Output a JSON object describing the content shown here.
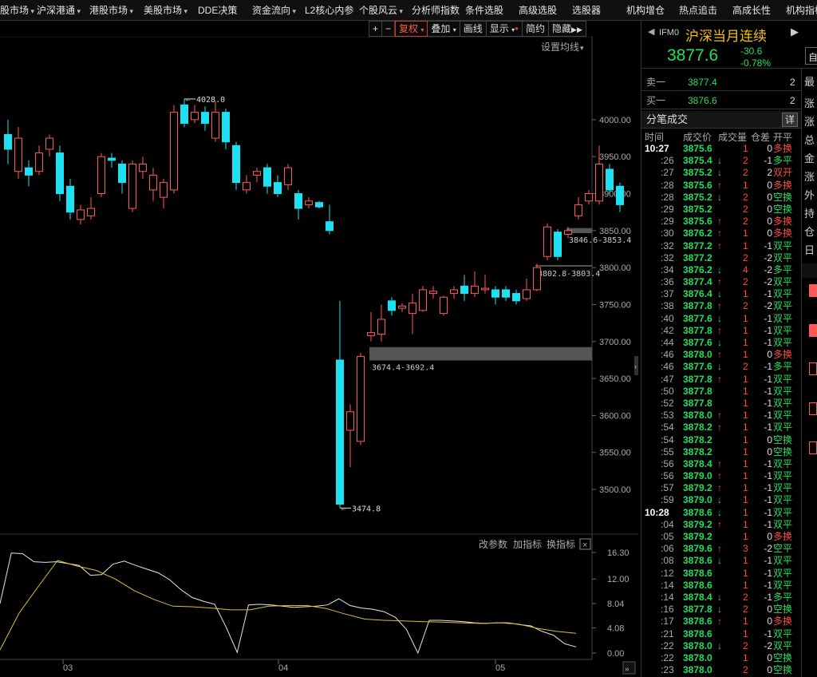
{
  "menu": [
    {
      "label": "股市场",
      "has_dropdown": true
    },
    {
      "label": "沪深港通",
      "has_dropdown": true
    },
    {
      "label": "港股市场",
      "has_dropdown": true
    },
    {
      "label": "美股市场",
      "has_dropdown": true
    },
    {
      "label": "DDE决策",
      "has_dropdown": false
    },
    {
      "label": "资金流向",
      "has_dropdown": true
    },
    {
      "label": "L2核心内参",
      "has_dropdown": false
    },
    {
      "label": "个股风云",
      "has_dropdown": true
    },
    {
      "label": "分析师指数",
      "has_dropdown": false
    },
    {
      "label": "条件选股",
      "has_dropdown": false
    },
    {
      "label": "高级选股",
      "has_dropdown": false
    },
    {
      "label": "选股器",
      "has_dropdown": false
    },
    {
      "label": "机构增仓",
      "has_dropdown": false
    },
    {
      "label": "热点追击",
      "has_dropdown": false
    },
    {
      "label": "高成长性",
      "has_dropdown": false
    },
    {
      "label": "机构指标",
      "has_dropdown": false
    }
  ],
  "toolbar": {
    "plus": "+",
    "minus": "−",
    "fuquan": "复权",
    "diejia": "叠加",
    "huaxian": "画线",
    "xianshi": "显示",
    "jianyue": "简约",
    "yincang": "隐藏"
  },
  "chart_settings_label": "设置均线",
  "indicator_toolbar": {
    "params": "改参数",
    "add": "加指标",
    "change": "换指标"
  },
  "colors": {
    "up": "#ff5a5a",
    "down": "#1ee0f0",
    "bg": "#000000",
    "indicator_white": "#e8e8e8",
    "indicator_yellow": "#d8c02a",
    "price_green": "#22e05a",
    "price_red": "#ff4a3a"
  },
  "chart_data": {
    "type": "candlestick",
    "y_axis": {
      "ticks": [
        "4000.00",
        "3950.00",
        "3900.00",
        "3850.00",
        "3800.00",
        "3750.00",
        "3700.00",
        "3650.00",
        "3600.00",
        "3550.00",
        "3500.00"
      ],
      "range": [
        3445,
        4110
      ]
    },
    "x_axis": {
      "date_labels": [
        "03",
        "04",
        "05"
      ]
    },
    "candles": [
      {
        "o": 3980,
        "c": 3960,
        "h": 4000,
        "l": 3940
      },
      {
        "o": 3930,
        "c": 3975,
        "h": 3990,
        "l": 3920
      },
      {
        "o": 3935,
        "c": 3925,
        "h": 3945,
        "l": 3910
      },
      {
        "o": 3930,
        "c": 3955,
        "h": 3965,
        "l": 3925
      },
      {
        "o": 3960,
        "c": 3975,
        "h": 3980,
        "l": 3950
      },
      {
        "o": 3955,
        "c": 3900,
        "h": 3965,
        "l": 3890
      },
      {
        "o": 3910,
        "c": 3875,
        "h": 3920,
        "l": 3865
      },
      {
        "o": 3865,
        "c": 3878,
        "h": 3885,
        "l": 3858
      },
      {
        "o": 3870,
        "c": 3880,
        "h": 3895,
        "l": 3865
      },
      {
        "o": 3900,
        "c": 3950,
        "h": 3955,
        "l": 3895
      },
      {
        "o": 3948,
        "c": 3945,
        "h": 3955,
        "l": 3935
      },
      {
        "o": 3940,
        "c": 3915,
        "h": 3945,
        "l": 3900
      },
      {
        "o": 3880,
        "c": 3940,
        "h": 3945,
        "l": 3875
      },
      {
        "o": 3930,
        "c": 3940,
        "h": 3950,
        "l": 3920
      },
      {
        "o": 3905,
        "c": 3925,
        "h": 3935,
        "l": 3890
      },
      {
        "o": 3895,
        "c": 3915,
        "h": 3920,
        "l": 3880
      },
      {
        "o": 3905,
        "c": 4010,
        "h": 4020,
        "l": 3900
      },
      {
        "o": 4020,
        "c": 3995,
        "h": 4028,
        "l": 3990
      },
      {
        "o": 4000,
        "c": 4010,
        "h": 4020,
        "l": 3995
      },
      {
        "o": 4010,
        "c": 3995,
        "h": 4018,
        "l": 3985
      },
      {
        "o": 3975,
        "c": 4010,
        "h": 4025,
        "l": 3970
      },
      {
        "o": 4010,
        "c": 3970,
        "h": 4015,
        "l": 3960
      },
      {
        "o": 3965,
        "c": 3915,
        "h": 3970,
        "l": 3905
      },
      {
        "o": 3905,
        "c": 3915,
        "h": 3925,
        "l": 3900
      },
      {
        "o": 3925,
        "c": 3930,
        "h": 3935,
        "l": 3915
      },
      {
        "o": 3935,
        "c": 3910,
        "h": 3940,
        "l": 3900
      },
      {
        "o": 3915,
        "c": 3900,
        "h": 3925,
        "l": 3895
      },
      {
        "o": 3912,
        "c": 3935,
        "h": 3940,
        "l": 3905
      },
      {
        "o": 3900,
        "c": 3880,
        "h": 3905,
        "l": 3865
      },
      {
        "o": 3885,
        "c": 3890,
        "h": 3895,
        "l": 3880
      },
      {
        "o": 3888,
        "c": 3882,
        "h": 3890,
        "l": 3880
      },
      {
        "o": 3862,
        "c": 3850,
        "h": 3885,
        "l": 3845
      },
      {
        "o": 3675,
        "c": 3480,
        "h": 3755,
        "l": 3474.8
      },
      {
        "o": 3580,
        "c": 3605,
        "h": 3615,
        "l": 3530
      },
      {
        "o": 3565,
        "c": 3680,
        "h": 3685,
        "l": 3560
      },
      {
        "o": 3708,
        "c": 3712,
        "h": 3740,
        "l": 3700
      },
      {
        "o": 3710,
        "c": 3730,
        "h": 3750,
        "l": 3700
      },
      {
        "o": 3755,
        "c": 3742,
        "h": 3760,
        "l": 3735
      },
      {
        "o": 3745,
        "c": 3748,
        "h": 3752,
        "l": 3740
      },
      {
        "o": 3738,
        "c": 3752,
        "h": 3765,
        "l": 3710
      },
      {
        "o": 3742,
        "c": 3770,
        "h": 3775,
        "l": 3740
      },
      {
        "o": 3765,
        "c": 3768,
        "h": 3775,
        "l": 3758
      },
      {
        "o": 3738,
        "c": 3760,
        "h": 3762,
        "l": 3735
      },
      {
        "o": 3765,
        "c": 3770,
        "h": 3775,
        "l": 3758
      },
      {
        "o": 3775,
        "c": 3765,
        "h": 3790,
        "l": 3755
      },
      {
        "o": 3765,
        "c": 3775,
        "h": 3795,
        "l": 3760
      },
      {
        "o": 3770,
        "c": 3772,
        "h": 3790,
        "l": 3765
      },
      {
        "o": 3770,
        "c": 3760,
        "h": 3775,
        "l": 3750
      },
      {
        "o": 3770,
        "c": 3760,
        "h": 3775,
        "l": 3755
      },
      {
        "o": 3765,
        "c": 3755,
        "h": 3770,
        "l": 3750
      },
      {
        "o": 3758,
        "c": 3770,
        "h": 3785,
        "l": 3755
      },
      {
        "o": 3770,
        "c": 3800,
        "h": 3805,
        "l": 3768
      },
      {
        "o": 3815,
        "c": 3855,
        "h": 3860,
        "l": 3810
      },
      {
        "o": 3848,
        "c": 3815,
        "h": 3852,
        "l": 3810
      },
      {
        "o": 3845,
        "c": 3850,
        "h": 3855,
        "l": 3840
      },
      {
        "o": 3870,
        "c": 3885,
        "h": 3895,
        "l": 3865
      },
      {
        "o": 3890,
        "c": 3900,
        "h": 3905,
        "l": 3885
      },
      {
        "o": 3890,
        "c": 3940,
        "h": 3965,
        "l": 3885
      },
      {
        "o": 3933,
        "c": 3905,
        "h": 3940,
        "l": 3900
      },
      {
        "o": 3910,
        "c": 3885,
        "h": 3915,
        "l": 3875
      }
    ],
    "annotations": [
      {
        "text": "4028.0",
        "price": 4028,
        "candle": 17
      },
      {
        "text": "3474.8",
        "price": 3474.8,
        "candle": 32
      }
    ],
    "gaps": [
      {
        "label": "3674.4-3692.4",
        "low": 3674.4,
        "high": 3692.4,
        "from_candle": 35
      },
      {
        "label": "3802.8-3803.4",
        "low": 3802.8,
        "high": 3803.4,
        "from_candle": 51
      },
      {
        "label": "3846.6-3853.4",
        "low": 3846.6,
        "high": 3853.4,
        "from_candle": 54
      }
    ],
    "indicator": {
      "y_ticks": [
        "16.30",
        "12.00",
        "8.04",
        "4.08",
        "0.00"
      ],
      "range": [
        0,
        16.3
      ],
      "series": [
        {
          "color": "white",
          "values": [
            8.0,
            16.2,
            16.1,
            14.8,
            14.7,
            14.8,
            14.5,
            14.2,
            12.6,
            12.7,
            14.4,
            14.9,
            14.2,
            13.6,
            13.0,
            11.9,
            10.3,
            9.0,
            8.4,
            7.9,
            4.3,
            0.1,
            7.8,
            7.9,
            7.8,
            7.6,
            7.4,
            7.5,
            7.6,
            7.8,
            8.8,
            7.7,
            7.3,
            7.1,
            6.7,
            5.8,
            3.8,
            0.0,
            5.3,
            5.3,
            5.2,
            5.1,
            4.9,
            4.8,
            4.9,
            4.9,
            4.6,
            4.4,
            3.5,
            2.9,
            1.5,
            1.0
          ]
        },
        {
          "color": "yellow",
          "values": [
            0.5,
            6.5,
            10.8,
            15.0,
            14.1,
            13.4,
            12.0,
            10.1,
            8.7,
            7.6,
            7.5,
            7.3,
            7.0,
            7.0,
            7.6,
            7.7,
            7.7,
            7.2,
            6.3,
            5.5,
            5.3,
            5.2,
            5.1,
            5.0,
            4.9,
            4.8,
            4.9,
            4.7,
            4.0,
            3.5,
            3.2
          ]
        }
      ]
    }
  },
  "quote": {
    "code": "IFM0",
    "name": "沪深当月连续",
    "price": "3877.6",
    "change": "-30.6",
    "change_pct": "-0.78%",
    "sell1": {
      "label": "卖一",
      "price": "3877.4",
      "vol": "2"
    },
    "buy1": {
      "label": "买一",
      "price": "3876.6",
      "vol": "2"
    },
    "side_labels": [
      "最",
      "涨",
      "涨",
      "总",
      "金",
      "涨",
      "外",
      "持",
      "仓",
      "日"
    ],
    "tape_title": "分笔成交",
    "tape_btn": "详",
    "tape_headers": [
      "时间",
      "成交价",
      "成交量",
      "仓差",
      "开平"
    ]
  },
  "ticks": [
    {
      "t": "10:27",
      "p": "3875.6",
      "a": "",
      "v": "1",
      "d": "0",
      "k": "多换",
      "pc": "g",
      "kc": "r"
    },
    {
      "t": ":26",
      "p": "3875.4",
      "a": "↓",
      "v": "2",
      "d": "-1",
      "k": "多平",
      "pc": "g",
      "kc": "g"
    },
    {
      "t": ":27",
      "p": "3875.2",
      "a": "↓",
      "v": "2",
      "d": "2",
      "k": "双开",
      "pc": "g",
      "kc": "r"
    },
    {
      "t": ":28",
      "p": "3875.6",
      "a": "↑",
      "v": "1",
      "d": "0",
      "k": "多换",
      "pc": "g",
      "kc": "r"
    },
    {
      "t": ":28",
      "p": "3875.2",
      "a": "↓",
      "v": "2",
      "d": "0",
      "k": "空换",
      "pc": "g",
      "kc": "g"
    },
    {
      "t": ":29",
      "p": "3875.2",
      "a": "",
      "v": "2",
      "d": "0",
      "k": "空换",
      "pc": "g",
      "kc": "g"
    },
    {
      "t": ":29",
      "p": "3875.6",
      "a": "↑",
      "v": "2",
      "d": "0",
      "k": "多换",
      "pc": "g",
      "kc": "r"
    },
    {
      "t": ":30",
      "p": "3876.2",
      "a": "↑",
      "v": "1",
      "d": "0",
      "k": "多换",
      "pc": "g",
      "kc": "r"
    },
    {
      "t": ":32",
      "p": "3877.2",
      "a": "↑",
      "v": "1",
      "d": "-1",
      "k": "双平",
      "pc": "g",
      "kc": "g"
    },
    {
      "t": ":32",
      "p": "3877.2",
      "a": "",
      "v": "2",
      "d": "-2",
      "k": "双平",
      "pc": "g",
      "kc": "g"
    },
    {
      "t": ":34",
      "p": "3876.2",
      "a": "↓",
      "v": "4",
      "d": "-2",
      "k": "多平",
      "pc": "g",
      "kc": "g"
    },
    {
      "t": ":36",
      "p": "3877.4",
      "a": "↑",
      "v": "2",
      "d": "-2",
      "k": "双平",
      "pc": "g",
      "kc": "g"
    },
    {
      "t": ":37",
      "p": "3876.4",
      "a": "↓",
      "v": "1",
      "d": "-1",
      "k": "双平",
      "pc": "g",
      "kc": "g"
    },
    {
      "t": ":38",
      "p": "3877.8",
      "a": "↑",
      "v": "2",
      "d": "-2",
      "k": "双平",
      "pc": "g",
      "kc": "g"
    },
    {
      "t": ":40",
      "p": "3877.6",
      "a": "↓",
      "v": "1",
      "d": "-1",
      "k": "双平",
      "pc": "g",
      "kc": "g"
    },
    {
      "t": ":42",
      "p": "3877.8",
      "a": "↑",
      "v": "1",
      "d": "-1",
      "k": "双平",
      "pc": "g",
      "kc": "g"
    },
    {
      "t": ":44",
      "p": "3877.6",
      "a": "↓",
      "v": "1",
      "d": "-1",
      "k": "双平",
      "pc": "g",
      "kc": "g"
    },
    {
      "t": ":46",
      "p": "3878.0",
      "a": "↑",
      "v": "1",
      "d": "0",
      "k": "多换",
      "pc": "g",
      "kc": "r"
    },
    {
      "t": ":46",
      "p": "3877.6",
      "a": "↓",
      "v": "2",
      "d": "-1",
      "k": "多平",
      "pc": "g",
      "kc": "g"
    },
    {
      "t": ":47",
      "p": "3877.8",
      "a": "↑",
      "v": "1",
      "d": "-1",
      "k": "双平",
      "pc": "g",
      "kc": "g"
    },
    {
      "t": ":50",
      "p": "3877.8",
      "a": "",
      "v": "1",
      "d": "-1",
      "k": "双平",
      "pc": "g",
      "kc": "g"
    },
    {
      "t": ":52",
      "p": "3877.8",
      "a": "",
      "v": "1",
      "d": "-1",
      "k": "双平",
      "pc": "g",
      "kc": "g"
    },
    {
      "t": ":53",
      "p": "3878.0",
      "a": "↑",
      "v": "1",
      "d": "-1",
      "k": "双平",
      "pc": "g",
      "kc": "g"
    },
    {
      "t": ":54",
      "p": "3878.2",
      "a": "↑",
      "v": "1",
      "d": "-1",
      "k": "双平",
      "pc": "g",
      "kc": "g"
    },
    {
      "t": ":54",
      "p": "3878.2",
      "a": "",
      "v": "1",
      "d": "0",
      "k": "空换",
      "pc": "g",
      "kc": "g"
    },
    {
      "t": ":55",
      "p": "3878.2",
      "a": "",
      "v": "1",
      "d": "0",
      "k": "空换",
      "pc": "g",
      "kc": "g"
    },
    {
      "t": ":56",
      "p": "3878.4",
      "a": "↑",
      "v": "1",
      "d": "-1",
      "k": "双平",
      "pc": "g",
      "kc": "g"
    },
    {
      "t": ":56",
      "p": "3879.0",
      "a": "↑",
      "v": "1",
      "d": "-1",
      "k": "双平",
      "pc": "g",
      "kc": "g"
    },
    {
      "t": ":57",
      "p": "3879.2",
      "a": "↑",
      "v": "1",
      "d": "-1",
      "k": "双平",
      "pc": "g",
      "kc": "g"
    },
    {
      "t": ":59",
      "p": "3879.0",
      "a": "↓",
      "v": "1",
      "d": "-1",
      "k": "双平",
      "pc": "g",
      "kc": "g"
    },
    {
      "t": "10:28",
      "p": "3878.6",
      "a": "↓",
      "v": "1",
      "d": "-1",
      "k": "双平",
      "pc": "g",
      "kc": "g"
    },
    {
      "t": ":04",
      "p": "3879.2",
      "a": "↑",
      "v": "1",
      "d": "-1",
      "k": "双平",
      "pc": "g",
      "kc": "g"
    },
    {
      "t": ":05",
      "p": "3879.2",
      "a": "",
      "v": "1",
      "d": "0",
      "k": "多换",
      "pc": "g",
      "kc": "r"
    },
    {
      "t": ":06",
      "p": "3879.6",
      "a": "↑",
      "v": "3",
      "d": "-2",
      "k": "空平",
      "pc": "g",
      "kc": "g"
    },
    {
      "t": ":08",
      "p": "3878.6",
      "a": "↓",
      "v": "1",
      "d": "-1",
      "k": "双平",
      "pc": "g",
      "kc": "g"
    },
    {
      "t": ":12",
      "p": "3878.6",
      "a": "",
      "v": "1",
      "d": "-1",
      "k": "双平",
      "pc": "g",
      "kc": "g"
    },
    {
      "t": ":14",
      "p": "3878.6",
      "a": "",
      "v": "1",
      "d": "-1",
      "k": "双平",
      "pc": "g",
      "kc": "g"
    },
    {
      "t": ":14",
      "p": "3878.4",
      "a": "↓",
      "v": "2",
      "d": "-1",
      "k": "多平",
      "pc": "g",
      "kc": "g"
    },
    {
      "t": ":16",
      "p": "3877.8",
      "a": "↓",
      "v": "2",
      "d": "0",
      "k": "空换",
      "pc": "g",
      "kc": "g"
    },
    {
      "t": ":17",
      "p": "3878.6",
      "a": "↑",
      "v": "1",
      "d": "0",
      "k": "多换",
      "pc": "g",
      "kc": "r"
    },
    {
      "t": ":21",
      "p": "3878.6",
      "a": "",
      "v": "1",
      "d": "-1",
      "k": "双平",
      "pc": "g",
      "kc": "g"
    },
    {
      "t": ":22",
      "p": "3878.0",
      "a": "↓",
      "v": "2",
      "d": "-2",
      "k": "双平",
      "pc": "g",
      "kc": "g"
    },
    {
      "t": ":22",
      "p": "3878.0",
      "a": "",
      "v": "1",
      "d": "0",
      "k": "空换",
      "pc": "g",
      "kc": "g"
    },
    {
      "t": ":23",
      "p": "3878.0",
      "a": "",
      "v": "2",
      "d": "0",
      "k": "空换",
      "pc": "g",
      "kc": "g"
    }
  ]
}
